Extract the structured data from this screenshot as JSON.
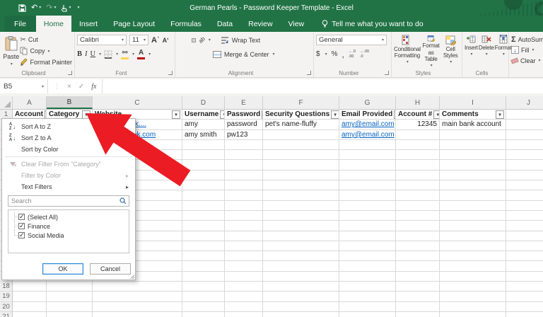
{
  "titlebar": {
    "title": "German Pearls - Password Keeper Template - Excel"
  },
  "tabs": {
    "file": "File",
    "items": [
      {
        "label": "Home",
        "active": true
      },
      {
        "label": "Insert"
      },
      {
        "label": "Page Layout"
      },
      {
        "label": "Formulas"
      },
      {
        "label": "Data"
      },
      {
        "label": "Review"
      },
      {
        "label": "View"
      }
    ],
    "tellme": "Tell me what you want to do"
  },
  "ribbon": {
    "clipboard": {
      "label": "Clipboard",
      "paste": "Paste",
      "cut": "Cut",
      "copy": "Copy",
      "format_painter": "Format Painter"
    },
    "font": {
      "label": "Font",
      "font_name": "Calibri",
      "font_size": "11",
      "bold": "B",
      "italic": "I",
      "underline": "U"
    },
    "alignment": {
      "label": "Alignment",
      "wrap_text": "Wrap Text",
      "merge_center": "Merge & Center",
      "orientation": "ab"
    },
    "number": {
      "label": "Number",
      "format": "General",
      "currency": "$",
      "percent": "%",
      "comma": ","
    },
    "styles": {
      "label": "Styles",
      "conditional": "Conditional Formatting",
      "format_table": "Format as Table",
      "cell_styles": "Cell Styles"
    },
    "cells": {
      "label": "Cells",
      "insert": "Insert",
      "delete": "Delete",
      "format": "Format"
    },
    "editing": {
      "autosum": "AutoSum",
      "fill": "Fill",
      "clear": "Clear"
    }
  },
  "formula_bar": {
    "name_box": "B5",
    "fx": "fx"
  },
  "sheet": {
    "selected_column": "B",
    "row_count": 21,
    "gutter_width": 18,
    "columns": [
      {
        "letter": "A",
        "width": 48,
        "header": "Account"
      },
      {
        "letter": "B",
        "width": 65,
        "header": "Category"
      },
      {
        "letter": "C",
        "width": 127,
        "header": "Website"
      },
      {
        "letter": "D",
        "width": 60,
        "header": "Username"
      },
      {
        "letter": "E",
        "width": 54,
        "header": "Password"
      },
      {
        "letter": "F",
        "width": 108,
        "header": "Security Questions"
      },
      {
        "letter": "G",
        "width": 80,
        "header": "Email Provided"
      },
      {
        "letter": "H",
        "width": 62,
        "header": "Account #"
      },
      {
        "letter": "I",
        "width": 94,
        "header": "Comments"
      },
      {
        "letter": "J",
        "width": 64,
        "header": ""
      }
    ],
    "data": [
      {
        "row": 2,
        "cells": [
          {
            "col": "C",
            "text": "www.abcbank....",
            "link": true
          },
          {
            "col": "D",
            "text": "amy"
          },
          {
            "col": "E",
            "text": "password"
          },
          {
            "col": "F",
            "text": "pet's name-fluffy"
          },
          {
            "col": "G",
            "text": "amy@email.com",
            "link": true
          },
          {
            "col": "H",
            "text": "12345",
            "align": "right"
          },
          {
            "col": "I",
            "text": "main bank account"
          }
        ]
      },
      {
        "row": 3,
        "cells": [
          {
            "col": "C",
            "text": "www.facebook.com",
            "link": true
          },
          {
            "col": "D",
            "text": "amy smith"
          },
          {
            "col": "E",
            "text": "pw123"
          },
          {
            "col": "G",
            "text": "amy@email.com",
            "link": true
          }
        ]
      }
    ]
  },
  "filter_menu": {
    "items": [
      {
        "label": "Sort A to Z",
        "icon": "sort-az",
        "enabled": true
      },
      {
        "label": "Sort Z to A",
        "icon": "sort-za",
        "enabled": true
      },
      {
        "label": "Sort by Color",
        "submenu": true,
        "enabled": true
      },
      {
        "separator": true
      },
      {
        "label": "Clear Filter From \"Category\"",
        "icon": "clear-filter",
        "enabled": false
      },
      {
        "label": "Filter by Color",
        "submenu": true,
        "enabled": false
      },
      {
        "label": "Text Filters",
        "submenu": true,
        "enabled": true
      }
    ],
    "search_placeholder": "Search",
    "checklist": [
      {
        "label": "(Select All)",
        "checked": true
      },
      {
        "label": "Finance",
        "checked": true
      },
      {
        "label": "Social Media",
        "checked": true
      }
    ],
    "ok": "OK",
    "cancel": "Cancel"
  },
  "colors": {
    "excel_green": "#217346",
    "link_blue": "#0563c1",
    "arrow_red": "#ec1c24"
  }
}
